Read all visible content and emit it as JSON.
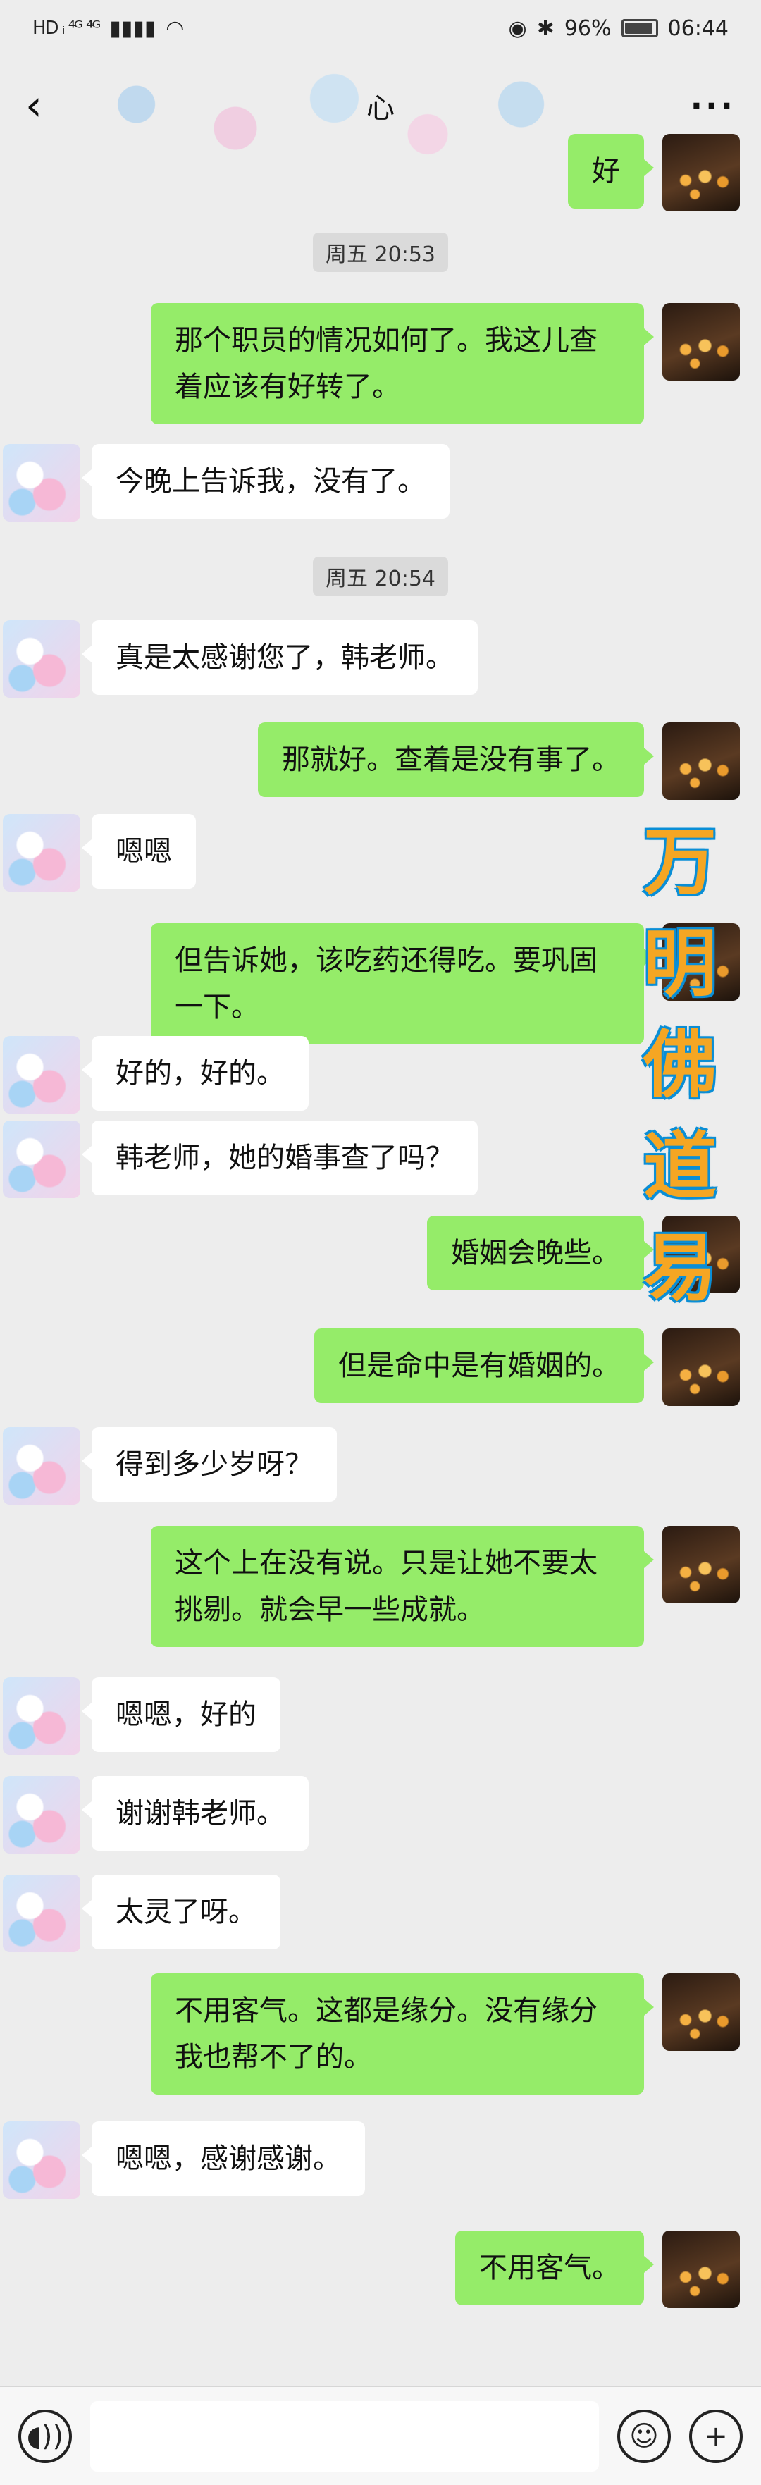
{
  "status_bar": {
    "left": "HD ᵢ ⁴ᴳ ⁴ᴳ",
    "battery": "96%",
    "time": "06:44"
  },
  "header": {
    "title": "心",
    "back_icon": "chevron-left-icon",
    "more_icon": "more-dots-icon"
  },
  "messages": [
    {
      "side": "out",
      "text": "好"
    },
    {
      "side": "time",
      "text": "周五 20:53"
    },
    {
      "side": "out",
      "text": "那个职员的情况如何了。我这儿查着应该有好转了。"
    },
    {
      "side": "in",
      "text": "今晚上告诉我，没有了。"
    },
    {
      "side": "time",
      "text": "周五 20:54"
    },
    {
      "side": "in",
      "text": "真是太感谢您了，韩老师。"
    },
    {
      "side": "out",
      "text": "那就好。查着是没有事了。"
    },
    {
      "side": "in",
      "text": "嗯嗯"
    },
    {
      "side": "out",
      "text": "但告诉她，该吃药还得吃。要巩固一下。"
    },
    {
      "side": "in",
      "text": "好的，好的。"
    },
    {
      "side": "in",
      "text": "韩老师，她的婚事查了吗？"
    },
    {
      "side": "out",
      "text": "婚姻会晚些。"
    },
    {
      "side": "out",
      "text": "但是命中是有婚姻的。"
    },
    {
      "side": "in",
      "text": "得到多少岁呀？"
    },
    {
      "side": "out",
      "text": "这个上在没有说。只是让她不要太挑剔。就会早一些成就。"
    },
    {
      "side": "in",
      "text": "嗯嗯，好的"
    },
    {
      "side": "in",
      "text": "谢谢韩老师。"
    },
    {
      "side": "in",
      "text": "太灵了呀。"
    },
    {
      "side": "out",
      "text": "不用客气。这都是缘分。没有缘分我也帮不了的。"
    },
    {
      "side": "in",
      "text": "嗯嗯，感谢感谢。"
    },
    {
      "side": "out",
      "text": "不用客气。"
    }
  ],
  "watermark": [
    "万",
    "明",
    "佛",
    "道",
    "易"
  ],
  "input_bar": {
    "voice_icon": "voice-icon",
    "emoji_icon": "emoji-icon",
    "add_icon": "plus-circle-icon"
  }
}
